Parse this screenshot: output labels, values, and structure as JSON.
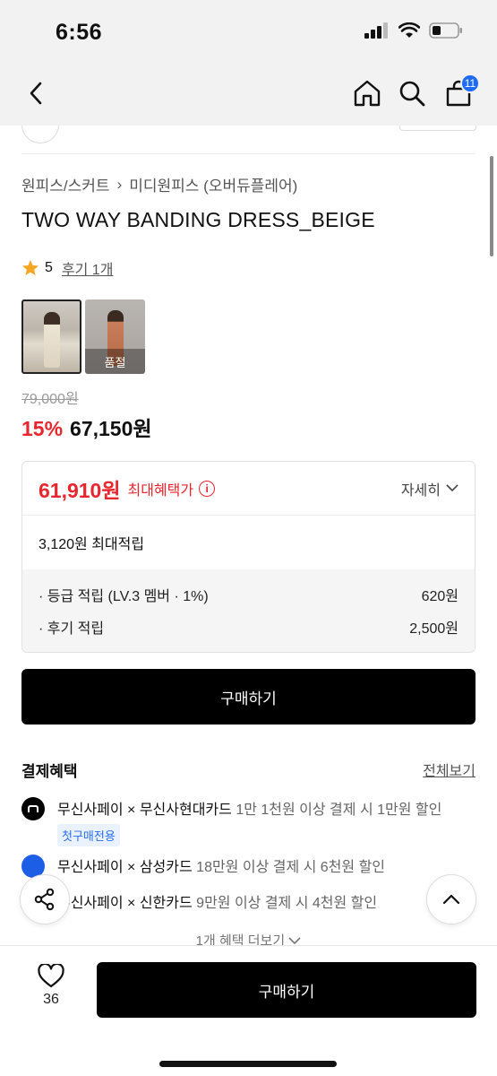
{
  "status": {
    "time": "6:56"
  },
  "nav": {
    "cart_count": "11"
  },
  "breadcrumb": {
    "category": "원피스/스커트",
    "separator": "›",
    "subcategory": "미디원피스 (오버듀플레어)"
  },
  "product": {
    "title": "TWO WAY BANDING DRESS_BEIGE",
    "rating": "5",
    "reviews": "후기 1개",
    "thumbnails": [
      {
        "selected": true,
        "label": ""
      },
      {
        "selected": false,
        "label": "품절"
      }
    ],
    "original_price": "79,000원",
    "discount": "15%",
    "price": "67,150원"
  },
  "benefit": {
    "max_price": "61,910원",
    "max_label": "최대혜택가",
    "detail": "자세히",
    "max_points": "3,120원 최대적립",
    "lines": [
      {
        "label": "· 등급 적립 (LV.3 멤버 · 1%)",
        "value": "620원"
      },
      {
        "label": "· 후기 적립",
        "value": "2,500원"
      }
    ]
  },
  "buy_label": "구매하기",
  "payment": {
    "title": "결제혜택",
    "see_all": "전체보기",
    "items": [
      {
        "strong": "무신사페이 × 무신사현대카드",
        "weak": " 1만 1천원 이상 결제 시 1만원 할인",
        "tag": "첫구매전용"
      },
      {
        "strong": "무신사페이 × 삼성카드",
        "weak": " 18만원 이상 결제 시 6천원 할인"
      },
      {
        "strong": "무신사페이 × 신한카드",
        "weak": " 9만원 이상 결제 시 4천원 할인"
      }
    ],
    "more": "1개 혜택 더보기"
  },
  "bottom": {
    "like_count": "36",
    "buy_label": "구매하기"
  },
  "colors": {
    "accent_red": "#e8262e",
    "badge_blue": "#1e6bf5",
    "tag_blue": "#2a6ef0"
  }
}
